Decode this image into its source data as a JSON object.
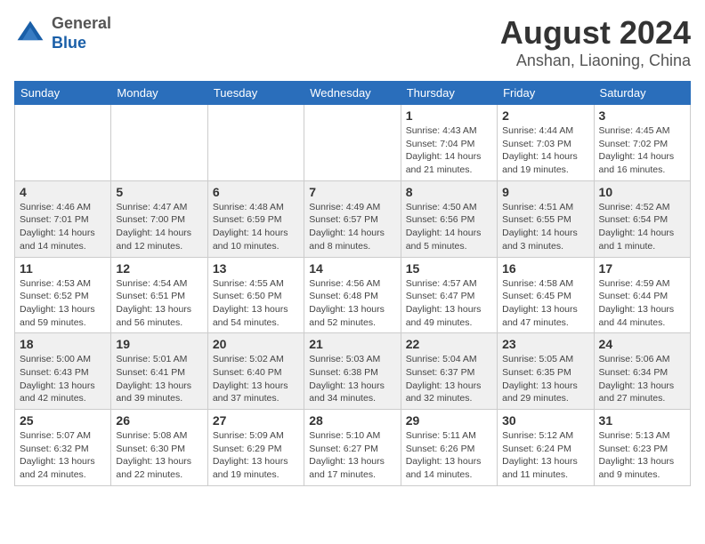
{
  "header": {
    "logo": {
      "line1": "General",
      "line2": "Blue"
    },
    "title": "August 2024",
    "subtitle": "Anshan, Liaoning, China"
  },
  "weekdays": [
    "Sunday",
    "Monday",
    "Tuesday",
    "Wednesday",
    "Thursday",
    "Friday",
    "Saturday"
  ],
  "weeks": [
    [
      {
        "day": "",
        "detail": ""
      },
      {
        "day": "",
        "detail": ""
      },
      {
        "day": "",
        "detail": ""
      },
      {
        "day": "",
        "detail": ""
      },
      {
        "day": "1",
        "detail": "Sunrise: 4:43 AM\nSunset: 7:04 PM\nDaylight: 14 hours\nand 21 minutes."
      },
      {
        "day": "2",
        "detail": "Sunrise: 4:44 AM\nSunset: 7:03 PM\nDaylight: 14 hours\nand 19 minutes."
      },
      {
        "day": "3",
        "detail": "Sunrise: 4:45 AM\nSunset: 7:02 PM\nDaylight: 14 hours\nand 16 minutes."
      }
    ],
    [
      {
        "day": "4",
        "detail": "Sunrise: 4:46 AM\nSunset: 7:01 PM\nDaylight: 14 hours\nand 14 minutes."
      },
      {
        "day": "5",
        "detail": "Sunrise: 4:47 AM\nSunset: 7:00 PM\nDaylight: 14 hours\nand 12 minutes."
      },
      {
        "day": "6",
        "detail": "Sunrise: 4:48 AM\nSunset: 6:59 PM\nDaylight: 14 hours\nand 10 minutes."
      },
      {
        "day": "7",
        "detail": "Sunrise: 4:49 AM\nSunset: 6:57 PM\nDaylight: 14 hours\nand 8 minutes."
      },
      {
        "day": "8",
        "detail": "Sunrise: 4:50 AM\nSunset: 6:56 PM\nDaylight: 14 hours\nand 5 minutes."
      },
      {
        "day": "9",
        "detail": "Sunrise: 4:51 AM\nSunset: 6:55 PM\nDaylight: 14 hours\nand 3 minutes."
      },
      {
        "day": "10",
        "detail": "Sunrise: 4:52 AM\nSunset: 6:54 PM\nDaylight: 14 hours\nand 1 minute."
      }
    ],
    [
      {
        "day": "11",
        "detail": "Sunrise: 4:53 AM\nSunset: 6:52 PM\nDaylight: 13 hours\nand 59 minutes."
      },
      {
        "day": "12",
        "detail": "Sunrise: 4:54 AM\nSunset: 6:51 PM\nDaylight: 13 hours\nand 56 minutes."
      },
      {
        "day": "13",
        "detail": "Sunrise: 4:55 AM\nSunset: 6:50 PM\nDaylight: 13 hours\nand 54 minutes."
      },
      {
        "day": "14",
        "detail": "Sunrise: 4:56 AM\nSunset: 6:48 PM\nDaylight: 13 hours\nand 52 minutes."
      },
      {
        "day": "15",
        "detail": "Sunrise: 4:57 AM\nSunset: 6:47 PM\nDaylight: 13 hours\nand 49 minutes."
      },
      {
        "day": "16",
        "detail": "Sunrise: 4:58 AM\nSunset: 6:45 PM\nDaylight: 13 hours\nand 47 minutes."
      },
      {
        "day": "17",
        "detail": "Sunrise: 4:59 AM\nSunset: 6:44 PM\nDaylight: 13 hours\nand 44 minutes."
      }
    ],
    [
      {
        "day": "18",
        "detail": "Sunrise: 5:00 AM\nSunset: 6:43 PM\nDaylight: 13 hours\nand 42 minutes."
      },
      {
        "day": "19",
        "detail": "Sunrise: 5:01 AM\nSunset: 6:41 PM\nDaylight: 13 hours\nand 39 minutes."
      },
      {
        "day": "20",
        "detail": "Sunrise: 5:02 AM\nSunset: 6:40 PM\nDaylight: 13 hours\nand 37 minutes."
      },
      {
        "day": "21",
        "detail": "Sunrise: 5:03 AM\nSunset: 6:38 PM\nDaylight: 13 hours\nand 34 minutes."
      },
      {
        "day": "22",
        "detail": "Sunrise: 5:04 AM\nSunset: 6:37 PM\nDaylight: 13 hours\nand 32 minutes."
      },
      {
        "day": "23",
        "detail": "Sunrise: 5:05 AM\nSunset: 6:35 PM\nDaylight: 13 hours\nand 29 minutes."
      },
      {
        "day": "24",
        "detail": "Sunrise: 5:06 AM\nSunset: 6:34 PM\nDaylight: 13 hours\nand 27 minutes."
      }
    ],
    [
      {
        "day": "25",
        "detail": "Sunrise: 5:07 AM\nSunset: 6:32 PM\nDaylight: 13 hours\nand 24 minutes."
      },
      {
        "day": "26",
        "detail": "Sunrise: 5:08 AM\nSunset: 6:30 PM\nDaylight: 13 hours\nand 22 minutes."
      },
      {
        "day": "27",
        "detail": "Sunrise: 5:09 AM\nSunset: 6:29 PM\nDaylight: 13 hours\nand 19 minutes."
      },
      {
        "day": "28",
        "detail": "Sunrise: 5:10 AM\nSunset: 6:27 PM\nDaylight: 13 hours\nand 17 minutes."
      },
      {
        "day": "29",
        "detail": "Sunrise: 5:11 AM\nSunset: 6:26 PM\nDaylight: 13 hours\nand 14 minutes."
      },
      {
        "day": "30",
        "detail": "Sunrise: 5:12 AM\nSunset: 6:24 PM\nDaylight: 13 hours\nand 11 minutes."
      },
      {
        "day": "31",
        "detail": "Sunrise: 5:13 AM\nSunset: 6:23 PM\nDaylight: 13 hours\nand 9 minutes."
      }
    ]
  ]
}
